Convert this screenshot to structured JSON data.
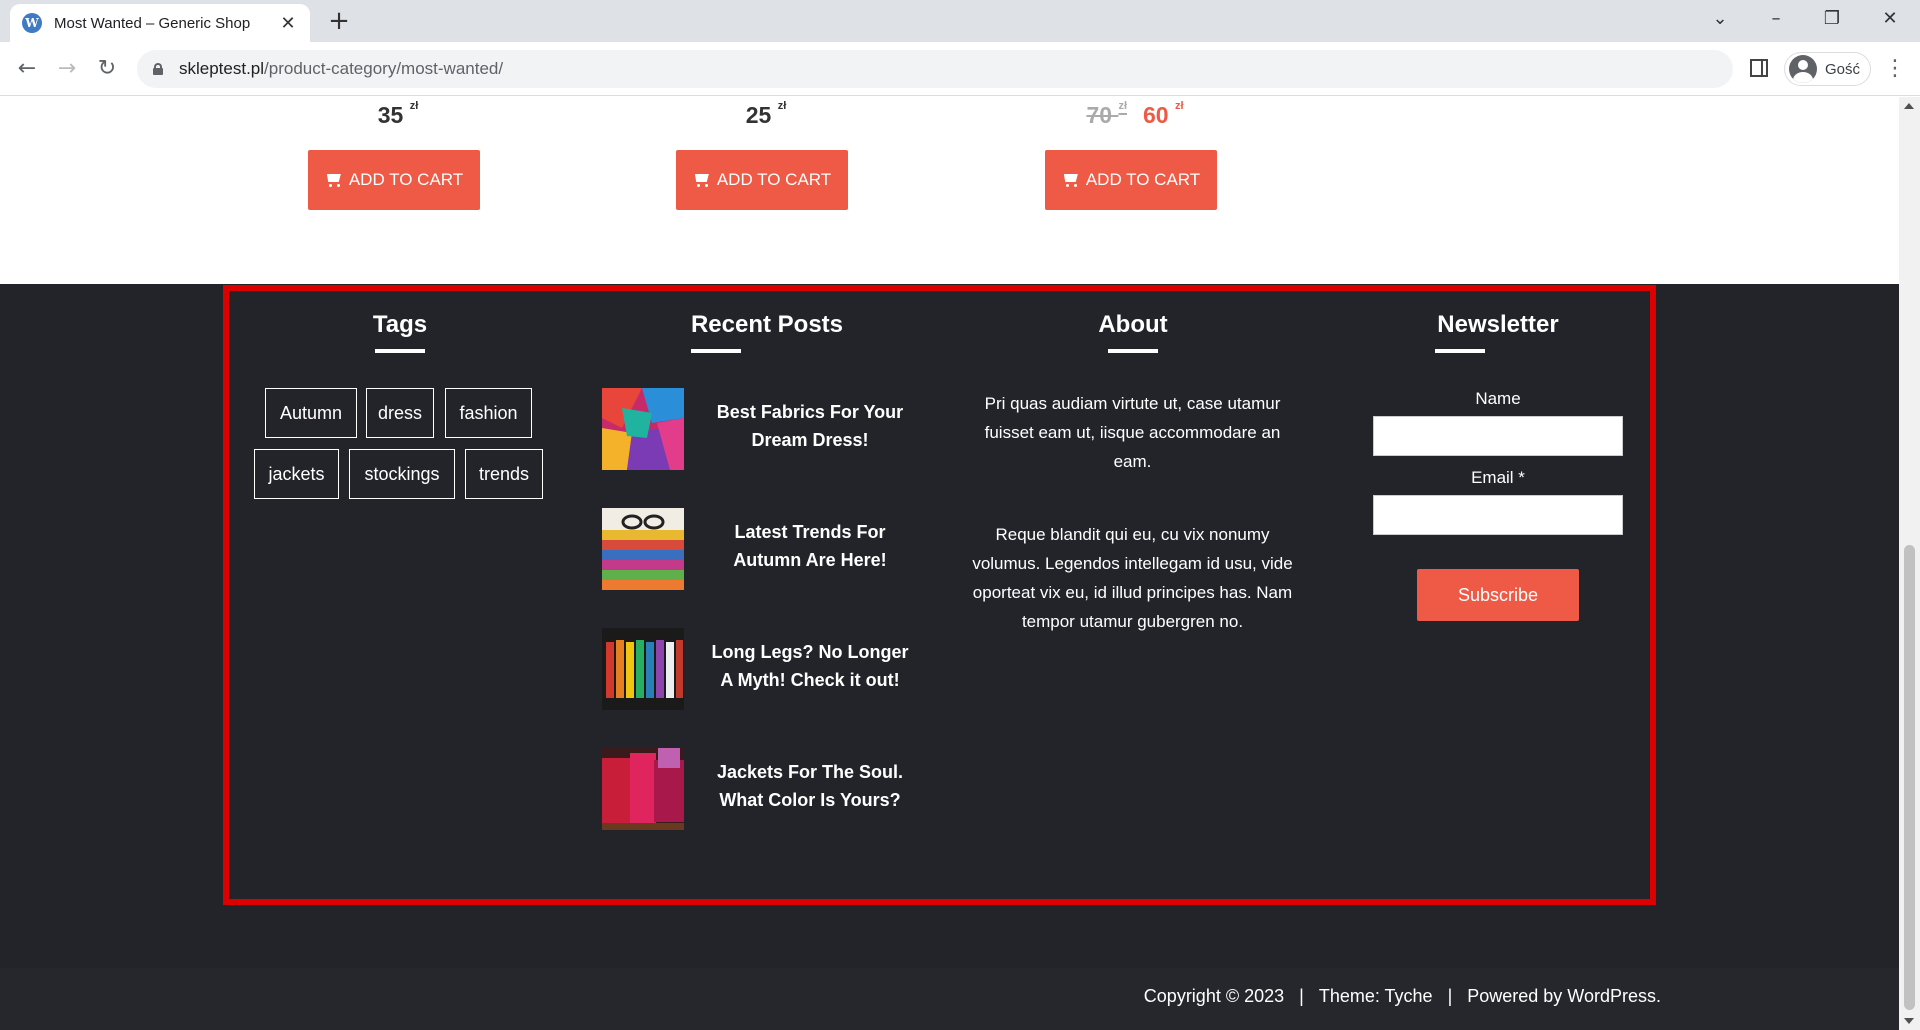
{
  "browser": {
    "tab_title": "Most Wanted – Generic Shop",
    "url_host": "skleptest.pl",
    "url_path": "/product-category/most-wanted/",
    "profile_name": "Gość"
  },
  "products": [
    {
      "price": "35",
      "currency": "zł",
      "button_label": "ADD TO CART"
    },
    {
      "price": "25",
      "currency": "zł",
      "button_label": "ADD TO CART"
    },
    {
      "old_price": "70",
      "price": "60",
      "currency": "zł",
      "button_label": "ADD TO CART"
    }
  ],
  "footer": {
    "tags": {
      "title": "Tags",
      "items": [
        "Autumn",
        "dress",
        "fashion",
        "jackets",
        "stockings",
        "trends"
      ]
    },
    "recent_posts": {
      "title": "Recent Posts",
      "items": [
        {
          "title": "Best Fabrics For Your Dream Dress!"
        },
        {
          "title": "Latest Trends For Autumn Are Here!"
        },
        {
          "title": "Long Legs? No Longer A Myth! Check it out!"
        },
        {
          "title": "Jackets For The Soul. What Color Is Yours?"
        }
      ]
    },
    "about": {
      "title": "About",
      "paragraph1": "Pri quas audiam virtute ut, case utamur fuisset eam ut, iisque accommodare an eam.",
      "paragraph2": "Reque blandit qui eu, cu vix nonumy volumus. Legendos intellegam id usu, vide oporteat vix eu, id illud principes has. Nam tempor utamur gubergren no."
    },
    "newsletter": {
      "title": "Newsletter",
      "name_label": "Name",
      "email_label": "Email *",
      "button_label": "Subscribe"
    },
    "copyright": {
      "text": "Copyright © 2023",
      "separator": "|",
      "theme": "Theme: Tyche",
      "powered": "Powered by WordPress."
    }
  },
  "colors": {
    "accent": "#ee5a45",
    "footer_bg": "#232429",
    "highlight": "#dd0000"
  }
}
